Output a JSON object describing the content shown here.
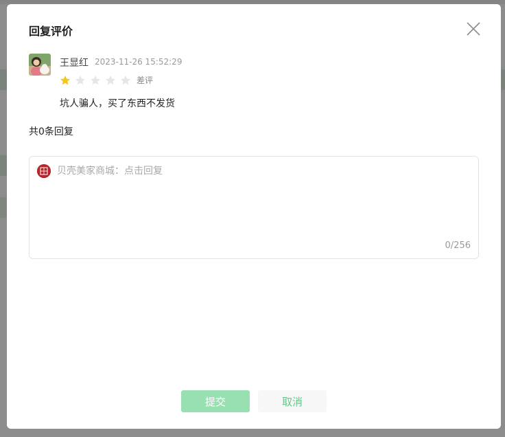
{
  "dialog": {
    "title": "回复评价"
  },
  "review": {
    "reviewer_name": "王显红",
    "timestamp": "2023-11-26 15:52:29",
    "rating": 1,
    "rating_max": 5,
    "rating_label": "差评",
    "content": "坑人骗人，买了东西不发货"
  },
  "replies": {
    "count_text": "共0条回复"
  },
  "reply_input": {
    "placeholder": "贝壳美家商城：点击回复",
    "value": "",
    "char_count": "0/256",
    "shop_logo_text": "贝壳美家"
  },
  "buttons": {
    "submit": "提交",
    "cancel": "取消"
  },
  "colors": {
    "star_active": "#f5c518",
    "star_inactive": "#e6e6e6",
    "submit_bg": "#98dfb2",
    "cancel_text": "#5fc88a",
    "shop_logo_bg": "#b3262c"
  },
  "icons": {
    "close": "close-icon",
    "star": "star-icon"
  }
}
